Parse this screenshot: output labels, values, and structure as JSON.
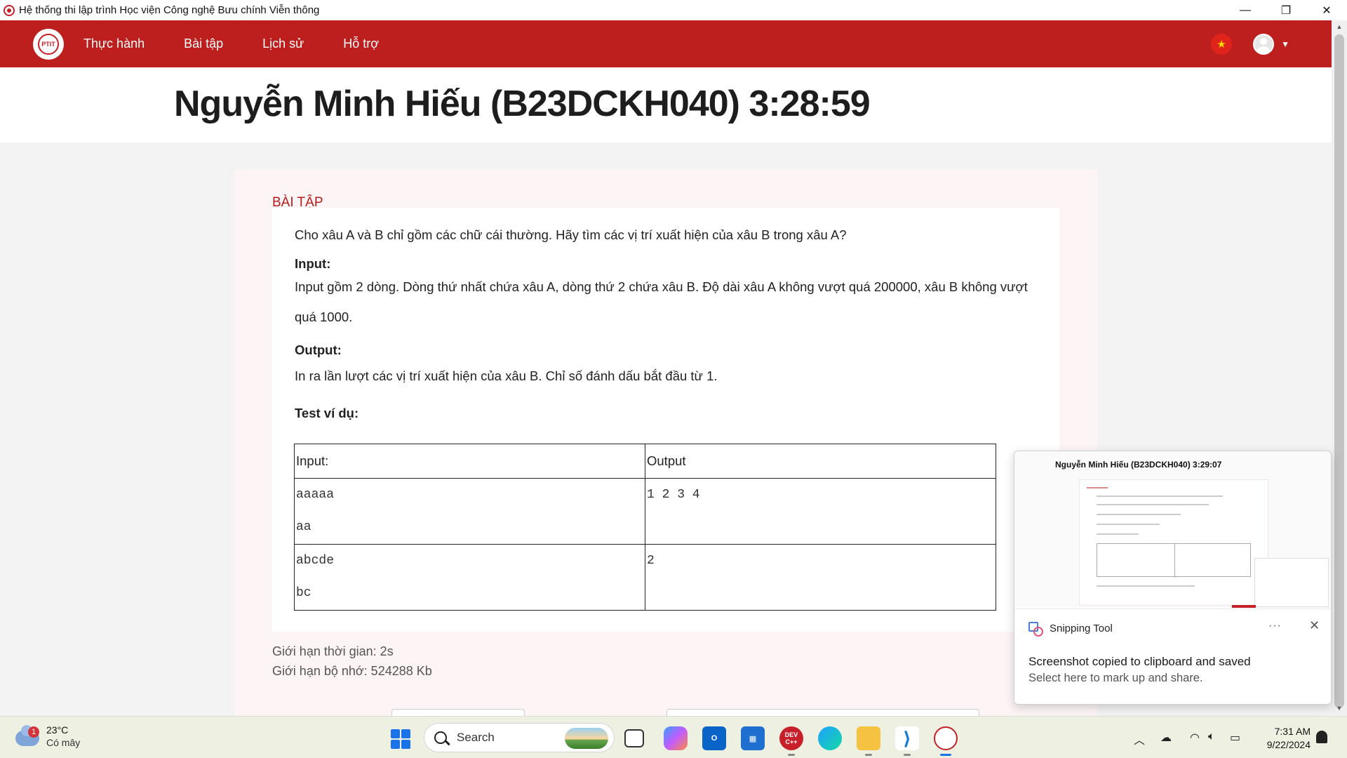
{
  "window": {
    "title": "Hệ thống thi lập trình Học viện Công nghệ Bưu chính Viễn thông",
    "controls": [
      "—",
      "❐",
      "✕"
    ]
  },
  "nav": {
    "logo_text": "PTIT",
    "items": [
      "Thực hành",
      "Bài tập",
      "Lịch sử",
      "Hỗ trợ"
    ],
    "flag_icon": "vietnam-flag-icon",
    "user_icon": "user-avatar-icon",
    "accent_color": "#bd1e1e"
  },
  "header": {
    "title": "Nguyễn Minh Hiếu (B23DCKH040)  3:28:59"
  },
  "problem": {
    "section_label": "BÀI TẬP",
    "statement": "Cho xâu A và B chỉ gồm các chữ cái thường. Hãy tìm các vị trí xuất hiện của xâu B trong xâu A?",
    "input_heading": "Input:",
    "input_text_line1": "Input gồm 2 dòng. Dòng thứ nhất chứa xâu A, dòng thứ 2 chứa xâu B. Độ dài xâu A không vượt quá 200000, xâu B không vượt",
    "input_text_line2": "quá 1000.",
    "output_heading": "Output:",
    "output_text": "In ra lần lượt các vị trí xuất hiện của xâu B. Chỉ số đánh dấu bắt đầu từ 1.",
    "example_heading": "Test ví dụ:",
    "table": {
      "headers": [
        "Input:",
        "Output"
      ],
      "rows": [
        {
          "input": [
            "aaaaa",
            "aa"
          ],
          "output": [
            "1 2 3 4"
          ]
        },
        {
          "input": [
            "abcde",
            "bc"
          ],
          "output": [
            "2"
          ]
        }
      ]
    },
    "time_limit": "Giới hạn thời gian: 2s",
    "memory_limit": "Giới hạn bộ nhớ: 524288 Kb"
  },
  "toast": {
    "preview_title": "Nguyễn Minh Hiếu (B23DCKH040) 3:29:07",
    "app_name": "Snipping Tool",
    "more": "···",
    "close": "✕",
    "message": "Screenshot copied to clipboard and saved",
    "sub_message": "Select here to mark up and share."
  },
  "taskbar": {
    "weather_temp": "23°C",
    "weather_cond": "Có mây",
    "weather_badge": "1",
    "search_label": "Search",
    "apps": [
      "task-view-icon",
      "copilot-icon",
      "outlook-icon",
      "microsoft-store-icon",
      "dev-cpp-icon",
      "edge-icon",
      "file-explorer-icon",
      "vscode-icon",
      "ptit-app-icon"
    ],
    "devcpp_label": "DEV C++",
    "outlook_label": "O",
    "time": "7:31 AM",
    "date": "9/22/2024"
  }
}
